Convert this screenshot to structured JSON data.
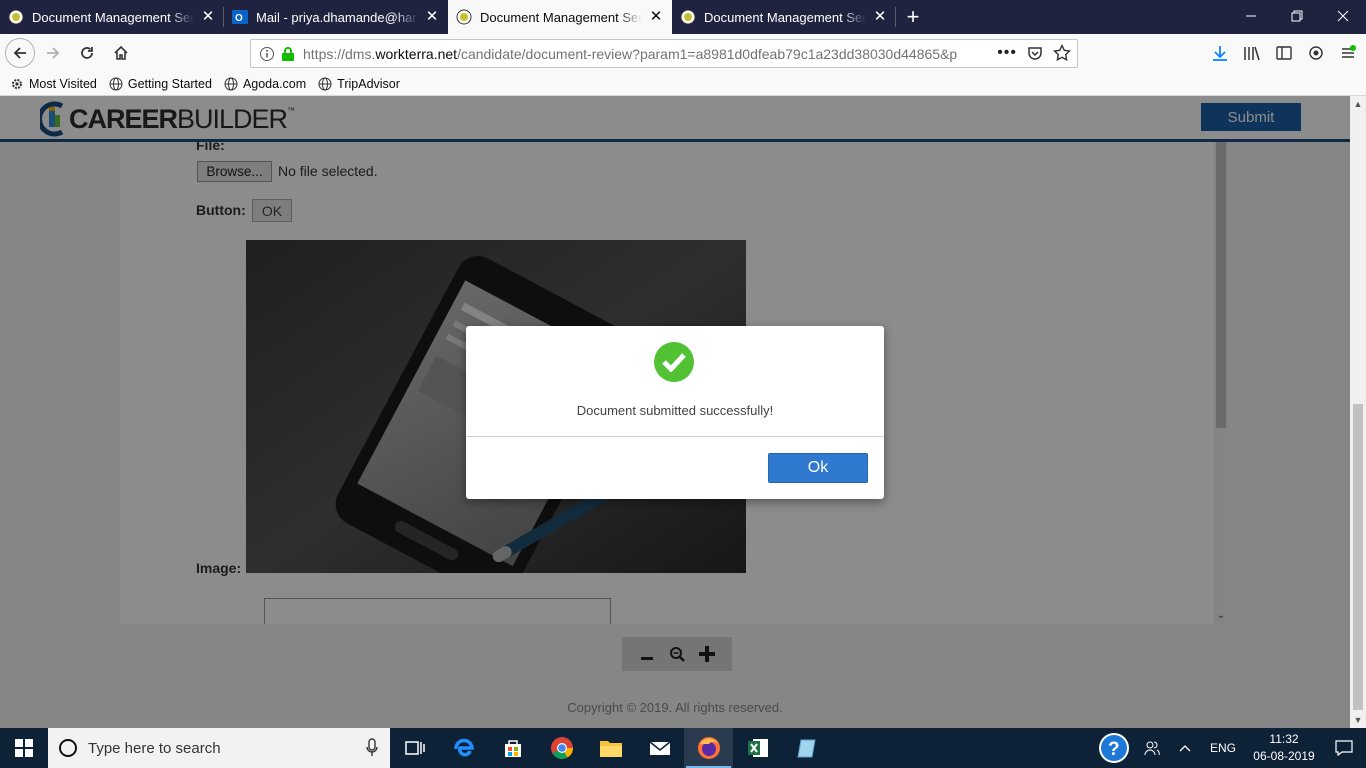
{
  "browser": {
    "tabs": [
      {
        "title": "Document Management Servic",
        "favicon": "dms-favicon",
        "active": false
      },
      {
        "title": "Mail - priya.dhamande@harbin",
        "favicon": "outlook-favicon",
        "active": false
      },
      {
        "title": "Document Management Servic",
        "favicon": "dms-favicon",
        "active": true
      },
      {
        "title": "Document Management Servic",
        "favicon": "dms-favicon",
        "active": false
      }
    ],
    "url_prefix": "https://dms.",
    "url_domain": "workterra.net",
    "url_rest": "/candidate/document-review?param1=a8981d0dfeab79c1a23dd38030d44865&p",
    "bookmarks": [
      {
        "label": "Most Visited",
        "icon": "gear-icon"
      },
      {
        "label": "Getting Started",
        "icon": "globe-icon"
      },
      {
        "label": "Agoda.com",
        "icon": "globe-icon"
      },
      {
        "label": "TripAdvisor",
        "icon": "globe-icon"
      }
    ]
  },
  "page": {
    "logo_bold": "CAREER",
    "logo_light": "BUILDER",
    "logo_tm": "™",
    "submit_label": "Submit",
    "file_label": "File:",
    "browse_label": "Browse...",
    "no_file_text": "No file selected.",
    "button_label": "Button:",
    "button_ok": "OK",
    "image_label": "Image:",
    "copyright": "Copyright © 2019. All rights reserved."
  },
  "modal": {
    "message": "Document submitted successfully!",
    "ok_label": "Ok",
    "icon": "check-circle-icon",
    "accent": "#52c234",
    "button_color": "#2f7ad0"
  },
  "taskbar": {
    "search_placeholder": "Type here to search",
    "lang": "ENG",
    "time": "11:32",
    "date": "06-08-2019"
  }
}
